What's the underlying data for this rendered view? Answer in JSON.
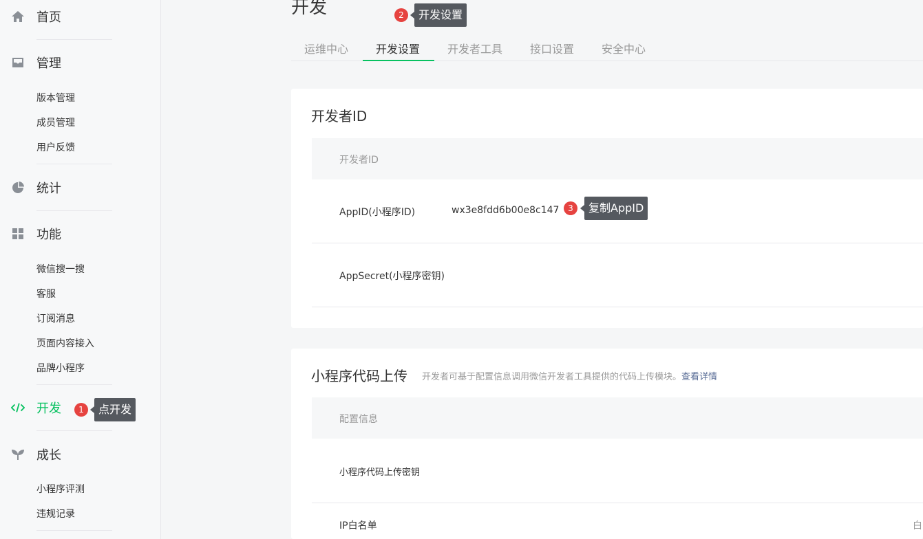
{
  "sidebar": {
    "home": "首页",
    "manage": "管理",
    "manage_items": [
      "版本管理",
      "成员管理",
      "用户反馈"
    ],
    "stats": "统计",
    "features": "功能",
    "feature_items": [
      "微信搜一搜",
      "客服",
      "订阅消息",
      "页面内容接入",
      "品牌小程序"
    ],
    "dev": "开发",
    "growth": "成长",
    "growth_items": [
      "小程序评测",
      "违规记录"
    ]
  },
  "page": {
    "title": "开发"
  },
  "tabs": [
    "运维中心",
    "开发设置",
    "开发者工具",
    "接口设置",
    "安全中心"
  ],
  "active_tab": "开发设置",
  "callouts": [
    {
      "num": "1",
      "text": "点开发"
    },
    {
      "num": "2",
      "text": "开发设置"
    },
    {
      "num": "3",
      "text": "复制AppID"
    }
  ],
  "developer_id": {
    "title": "开发者ID",
    "header": "开发者ID",
    "appid_label": "AppID(小程序ID)",
    "appid_value": "wx3e8fdd6b00e8c147",
    "secret_label": "AppSecret(小程序密钥)"
  },
  "code_upload": {
    "title": "小程序代码上传",
    "desc": "开发者可基于配置信息调用微信开发者工具提供的代码上传模块。",
    "link": "查看详情",
    "header": "配置信息",
    "key_label": "小程序代码上传密钥",
    "ip_label": "IP白名单",
    "ip_value_partial": "白"
  },
  "colors": {
    "accent": "#07c160",
    "badge": "#e64340",
    "tooltip": "#55595f",
    "link": "#576b95"
  }
}
